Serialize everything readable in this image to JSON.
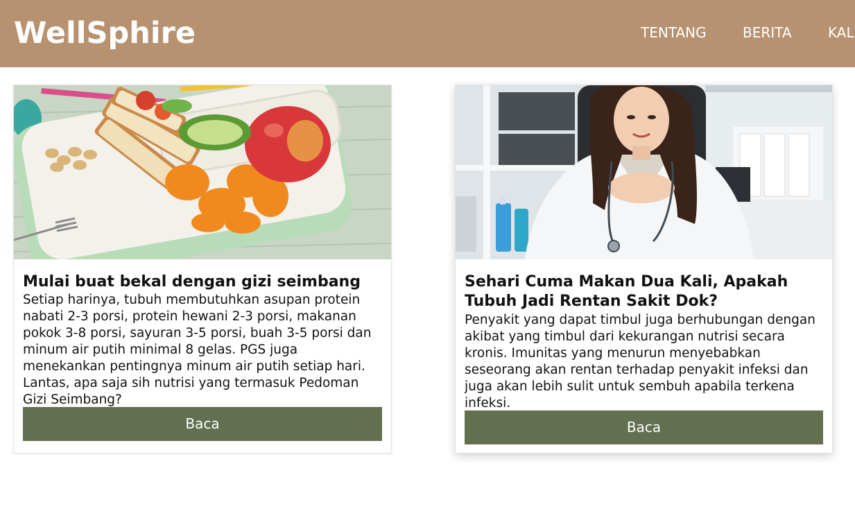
{
  "header": {
    "brand": "WellSphire",
    "nav": [
      {
        "label": "TENTANG"
      },
      {
        "label": "BERITA"
      },
      {
        "label": "KAL"
      }
    ],
    "background_color": "#b79270"
  },
  "cards": [
    {
      "image": "lunchbox-healthy-food-photo",
      "title": "Mulai buat bekal dengan gizi seimbang",
      "text": "Setiap harinya, tubuh membutuhkan asupan protein nabati 2-3 porsi, protein hewani 2-3 porsi, makanan pokok 3-8 porsi, sayuran 3-5 porsi, buah 3-5 porsi dan minum air putih minimal 8 gelas. PGS juga menekankan pentingnya minum air putih setiap hari. Lantas, apa saja sih nutrisi yang termasuk Pedoman Gizi Seimbang?",
      "button_label": "Baca"
    },
    {
      "image": "doctor-portrait-photo",
      "title": "Sehari Cuma Makan Dua Kali, Apakah Tubuh Jadi Rentan Sakit Dok?",
      "text": "Penyakit yang dapat timbul juga berhubungan dengan akibat yang timbul dari kekurangan nutrisi secara kronis. Imunitas yang menurun menyebabkan seseorang akan rentan terhadap penyakit infeksi dan juga akan lebih sulit untuk sembuh apabila terkena infeksi.",
      "button_label": "Baca"
    }
  ],
  "colors": {
    "button": "#627050",
    "header": "#b79270"
  }
}
